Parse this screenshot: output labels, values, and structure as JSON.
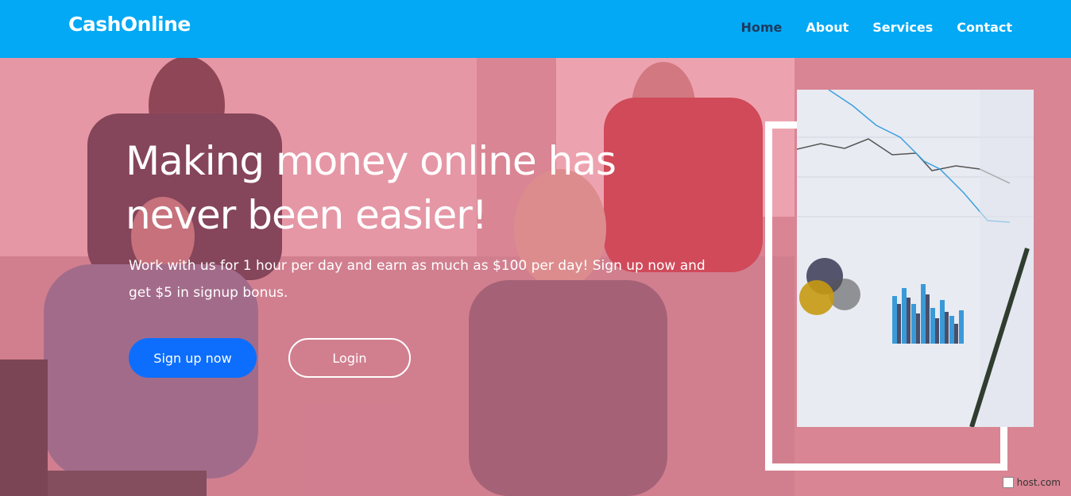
{
  "header": {
    "brand": "CashOnline",
    "nav": [
      {
        "label": "Home",
        "active": true
      },
      {
        "label": "About",
        "active": false
      },
      {
        "label": "Services",
        "active": false
      },
      {
        "label": "Contact",
        "active": false
      }
    ]
  },
  "hero": {
    "title": "Making money online has never been easier!",
    "subtitle": "Work with us for 1 hour per day and earn as much as $100 per day! Sign up now and get $5 in signup bonus.",
    "primary_button": "Sign up now",
    "secondary_button": "Login"
  },
  "footer": {
    "badge_text": "host.com"
  },
  "colors": {
    "navbar": "#03a9f4",
    "active_nav": "#1e3a5f",
    "primary_button": "#0d6efd",
    "overlay": "rgba(255,110,140,0.38)"
  }
}
